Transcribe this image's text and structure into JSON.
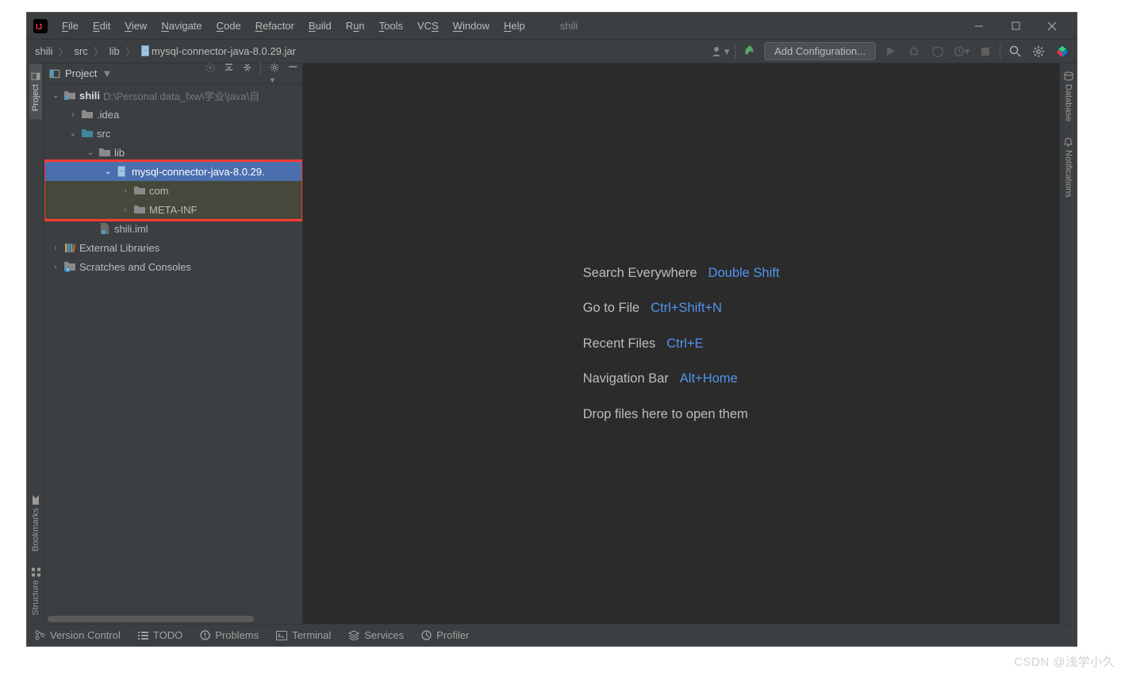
{
  "title": "shili",
  "menu": [
    "File",
    "Edit",
    "View",
    "Navigate",
    "Code",
    "Refactor",
    "Build",
    "Run",
    "Tools",
    "VCS",
    "Window",
    "Help"
  ],
  "breadcrumbs": [
    "shili",
    "src",
    "lib",
    "mysql-connector-java-8.0.29.jar"
  ],
  "add_config": "Add Configuration...",
  "project_label": "Project",
  "tree": {
    "root_name": "shili",
    "root_path": "D:\\Personal data_fxw\\学业\\java\\自",
    "idea": ".idea",
    "src": "src",
    "lib": "lib",
    "jar": "mysql-connector-java-8.0.29.",
    "com": "com",
    "metainf": "META-INF",
    "iml": "shili.iml",
    "external": "External Libraries",
    "scratches": "Scratches and Consoles"
  },
  "tips": [
    {
      "label": "Search Everywhere",
      "shortcut": "Double Shift"
    },
    {
      "label": "Go to File",
      "shortcut": "Ctrl+Shift+N"
    },
    {
      "label": "Recent Files",
      "shortcut": "Ctrl+E"
    },
    {
      "label": "Navigation Bar",
      "shortcut": "Alt+Home"
    }
  ],
  "drop_hint": "Drop files here to open them",
  "status": {
    "vcs": "Version Control",
    "todo": "TODO",
    "problems": "Problems",
    "terminal": "Terminal",
    "services": "Services",
    "profiler": "Profiler"
  },
  "left_tabs": {
    "project": "Project",
    "bookmarks": "Bookmarks",
    "structure": "Structure"
  },
  "right_tabs": {
    "database": "Database",
    "notifications": "Notifications"
  },
  "watermark": "CSDN @浅学小久"
}
